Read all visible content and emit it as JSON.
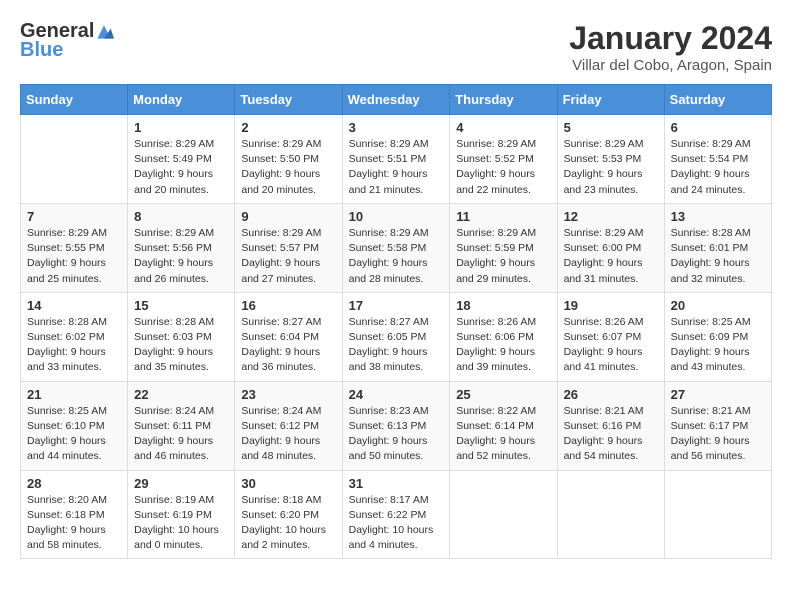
{
  "header": {
    "logo_general": "General",
    "logo_blue": "Blue",
    "month_year": "January 2024",
    "location": "Villar del Cobo, Aragon, Spain"
  },
  "days_of_week": [
    "Sunday",
    "Monday",
    "Tuesday",
    "Wednesday",
    "Thursday",
    "Friday",
    "Saturday"
  ],
  "weeks": [
    [
      {
        "day": "",
        "sunrise": "",
        "sunset": "",
        "daylight": ""
      },
      {
        "day": "1",
        "sunrise": "Sunrise: 8:29 AM",
        "sunset": "Sunset: 5:49 PM",
        "daylight": "Daylight: 9 hours and 20 minutes."
      },
      {
        "day": "2",
        "sunrise": "Sunrise: 8:29 AM",
        "sunset": "Sunset: 5:50 PM",
        "daylight": "Daylight: 9 hours and 20 minutes."
      },
      {
        "day": "3",
        "sunrise": "Sunrise: 8:29 AM",
        "sunset": "Sunset: 5:51 PM",
        "daylight": "Daylight: 9 hours and 21 minutes."
      },
      {
        "day": "4",
        "sunrise": "Sunrise: 8:29 AM",
        "sunset": "Sunset: 5:52 PM",
        "daylight": "Daylight: 9 hours and 22 minutes."
      },
      {
        "day": "5",
        "sunrise": "Sunrise: 8:29 AM",
        "sunset": "Sunset: 5:53 PM",
        "daylight": "Daylight: 9 hours and 23 minutes."
      },
      {
        "day": "6",
        "sunrise": "Sunrise: 8:29 AM",
        "sunset": "Sunset: 5:54 PM",
        "daylight": "Daylight: 9 hours and 24 minutes."
      }
    ],
    [
      {
        "day": "7",
        "sunrise": "Sunrise: 8:29 AM",
        "sunset": "Sunset: 5:55 PM",
        "daylight": "Daylight: 9 hours and 25 minutes."
      },
      {
        "day": "8",
        "sunrise": "Sunrise: 8:29 AM",
        "sunset": "Sunset: 5:56 PM",
        "daylight": "Daylight: 9 hours and 26 minutes."
      },
      {
        "day": "9",
        "sunrise": "Sunrise: 8:29 AM",
        "sunset": "Sunset: 5:57 PM",
        "daylight": "Daylight: 9 hours and 27 minutes."
      },
      {
        "day": "10",
        "sunrise": "Sunrise: 8:29 AM",
        "sunset": "Sunset: 5:58 PM",
        "daylight": "Daylight: 9 hours and 28 minutes."
      },
      {
        "day": "11",
        "sunrise": "Sunrise: 8:29 AM",
        "sunset": "Sunset: 5:59 PM",
        "daylight": "Daylight: 9 hours and 29 minutes."
      },
      {
        "day": "12",
        "sunrise": "Sunrise: 8:29 AM",
        "sunset": "Sunset: 6:00 PM",
        "daylight": "Daylight: 9 hours and 31 minutes."
      },
      {
        "day": "13",
        "sunrise": "Sunrise: 8:28 AM",
        "sunset": "Sunset: 6:01 PM",
        "daylight": "Daylight: 9 hours and 32 minutes."
      }
    ],
    [
      {
        "day": "14",
        "sunrise": "Sunrise: 8:28 AM",
        "sunset": "Sunset: 6:02 PM",
        "daylight": "Daylight: 9 hours and 33 minutes."
      },
      {
        "day": "15",
        "sunrise": "Sunrise: 8:28 AM",
        "sunset": "Sunset: 6:03 PM",
        "daylight": "Daylight: 9 hours and 35 minutes."
      },
      {
        "day": "16",
        "sunrise": "Sunrise: 8:27 AM",
        "sunset": "Sunset: 6:04 PM",
        "daylight": "Daylight: 9 hours and 36 minutes."
      },
      {
        "day": "17",
        "sunrise": "Sunrise: 8:27 AM",
        "sunset": "Sunset: 6:05 PM",
        "daylight": "Daylight: 9 hours and 38 minutes."
      },
      {
        "day": "18",
        "sunrise": "Sunrise: 8:26 AM",
        "sunset": "Sunset: 6:06 PM",
        "daylight": "Daylight: 9 hours and 39 minutes."
      },
      {
        "day": "19",
        "sunrise": "Sunrise: 8:26 AM",
        "sunset": "Sunset: 6:07 PM",
        "daylight": "Daylight: 9 hours and 41 minutes."
      },
      {
        "day": "20",
        "sunrise": "Sunrise: 8:25 AM",
        "sunset": "Sunset: 6:09 PM",
        "daylight": "Daylight: 9 hours and 43 minutes."
      }
    ],
    [
      {
        "day": "21",
        "sunrise": "Sunrise: 8:25 AM",
        "sunset": "Sunset: 6:10 PM",
        "daylight": "Daylight: 9 hours and 44 minutes."
      },
      {
        "day": "22",
        "sunrise": "Sunrise: 8:24 AM",
        "sunset": "Sunset: 6:11 PM",
        "daylight": "Daylight: 9 hours and 46 minutes."
      },
      {
        "day": "23",
        "sunrise": "Sunrise: 8:24 AM",
        "sunset": "Sunset: 6:12 PM",
        "daylight": "Daylight: 9 hours and 48 minutes."
      },
      {
        "day": "24",
        "sunrise": "Sunrise: 8:23 AM",
        "sunset": "Sunset: 6:13 PM",
        "daylight": "Daylight: 9 hours and 50 minutes."
      },
      {
        "day": "25",
        "sunrise": "Sunrise: 8:22 AM",
        "sunset": "Sunset: 6:14 PM",
        "daylight": "Daylight: 9 hours and 52 minutes."
      },
      {
        "day": "26",
        "sunrise": "Sunrise: 8:21 AM",
        "sunset": "Sunset: 6:16 PM",
        "daylight": "Daylight: 9 hours and 54 minutes."
      },
      {
        "day": "27",
        "sunrise": "Sunrise: 8:21 AM",
        "sunset": "Sunset: 6:17 PM",
        "daylight": "Daylight: 9 hours and 56 minutes."
      }
    ],
    [
      {
        "day": "28",
        "sunrise": "Sunrise: 8:20 AM",
        "sunset": "Sunset: 6:18 PM",
        "daylight": "Daylight: 9 hours and 58 minutes."
      },
      {
        "day": "29",
        "sunrise": "Sunrise: 8:19 AM",
        "sunset": "Sunset: 6:19 PM",
        "daylight": "Daylight: 10 hours and 0 minutes."
      },
      {
        "day": "30",
        "sunrise": "Sunrise: 8:18 AM",
        "sunset": "Sunset: 6:20 PM",
        "daylight": "Daylight: 10 hours and 2 minutes."
      },
      {
        "day": "31",
        "sunrise": "Sunrise: 8:17 AM",
        "sunset": "Sunset: 6:22 PM",
        "daylight": "Daylight: 10 hours and 4 minutes."
      },
      {
        "day": "",
        "sunrise": "",
        "sunset": "",
        "daylight": ""
      },
      {
        "day": "",
        "sunrise": "",
        "sunset": "",
        "daylight": ""
      },
      {
        "day": "",
        "sunrise": "",
        "sunset": "",
        "daylight": ""
      }
    ]
  ]
}
